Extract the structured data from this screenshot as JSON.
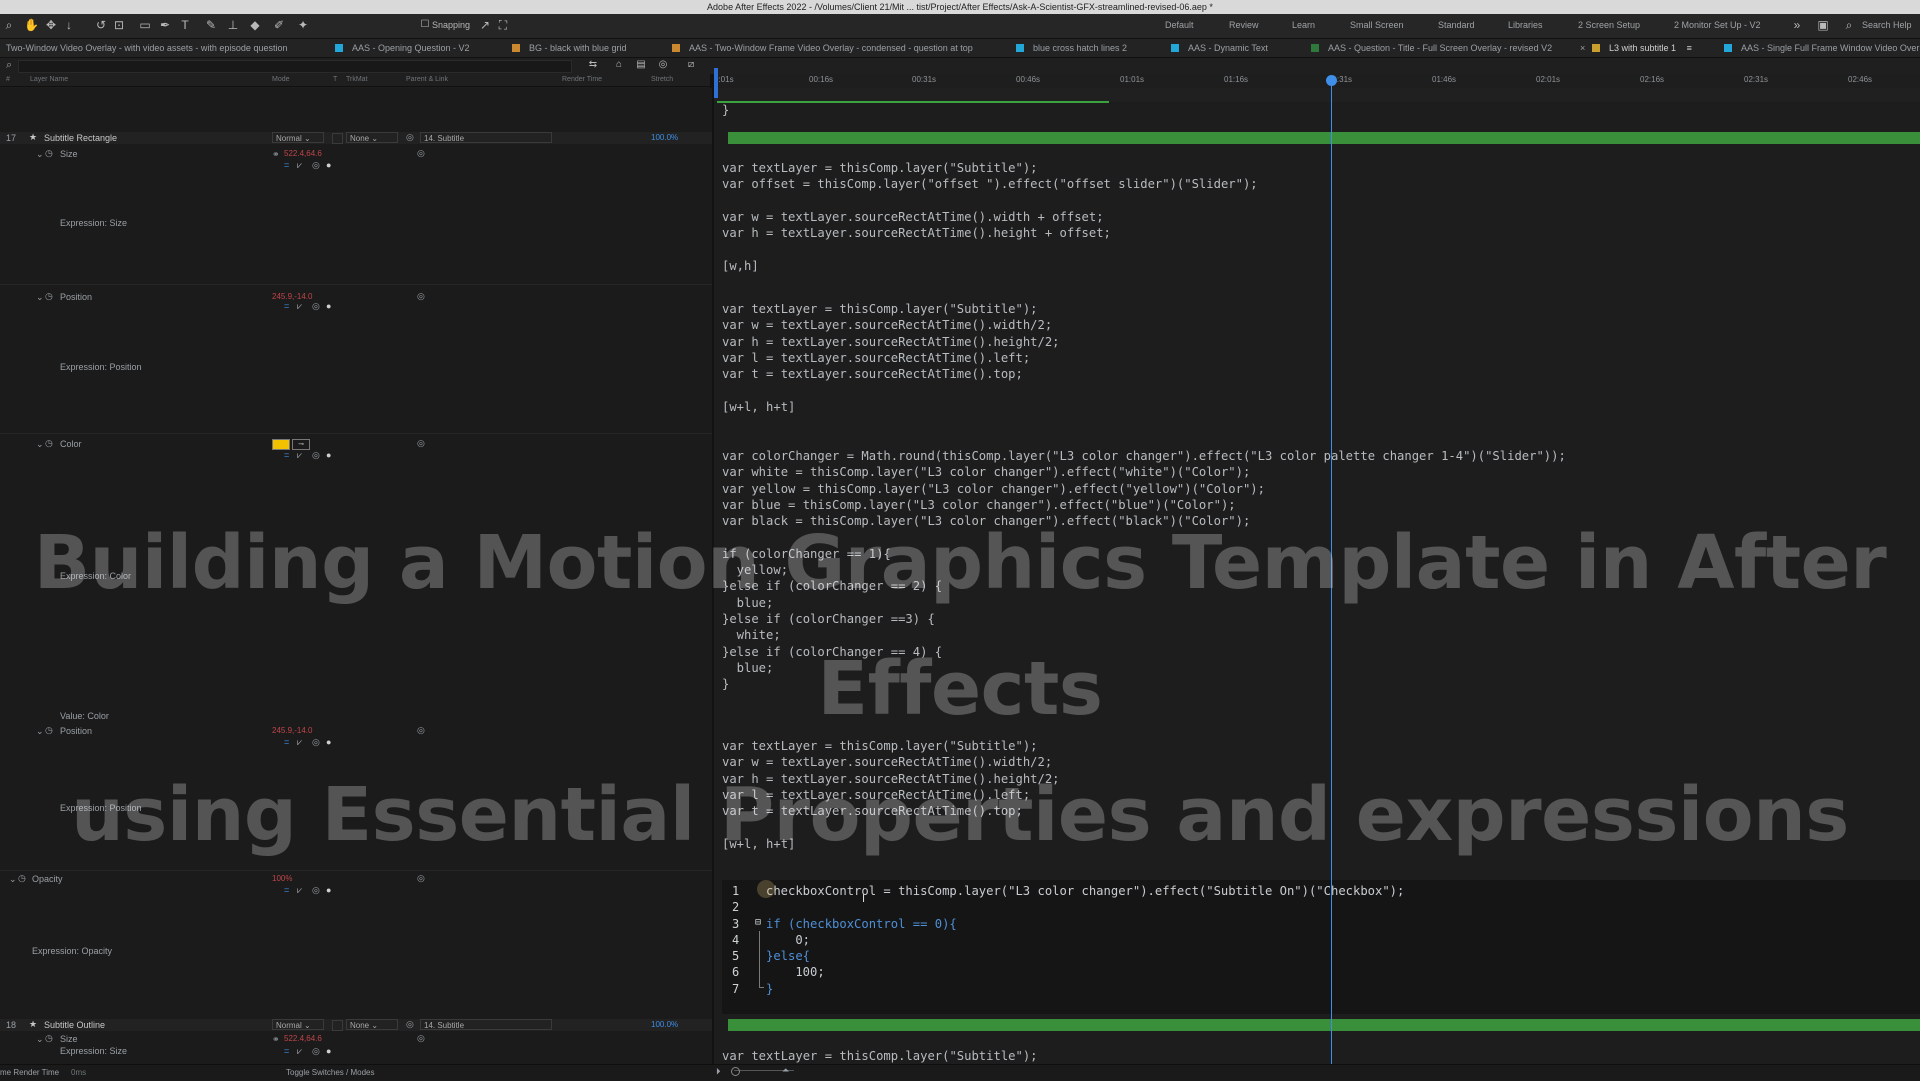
{
  "window": {
    "title": "Adobe After Effects 2022 - /Volumes/Client 21/Mit ... tist/Project/After Effects/Ask-A-Scientist-GFX-streamlined-revised-06.aep *"
  },
  "toolbar": {
    "snapping_label": "Snapping",
    "workspaces": [
      "Default",
      "Review",
      "Learn",
      "Small Screen",
      "Standard",
      "Libraries",
      "2 Screen Setup",
      "2 Monitor Set Up - V2"
    ],
    "search_help": "Search Help"
  },
  "tabs": [
    {
      "label": "Two-Window Video Overlay - with video assets - with episode question",
      "color": ""
    },
    {
      "label": "AAS - Opening Question - V2",
      "color": "#23a7d8"
    },
    {
      "label": "BG - black with blue grid",
      "color": "#c98a2f"
    },
    {
      "label": "AAS - Two-Window Frame Video Overlay - condensed - question at top",
      "color": "#c98a2f"
    },
    {
      "label": "blue cross hatch lines 2",
      "color": "#23a7d8"
    },
    {
      "label": "AAS - Dynamic Text",
      "color": "#23a7d8"
    },
    {
      "label": "AAS - Question - Title - Full Screen Overlay - revised V2",
      "color": "#2f7a3a"
    },
    {
      "label": "L3 with subtitle 1",
      "color": "#c9a030",
      "active": true
    },
    {
      "label": "AAS - Single Full Frame Window Video Over",
      "color": "#23a7d8"
    }
  ],
  "columns": {
    "num": "#",
    "layer_name": "Layer Name",
    "mode": "Mode",
    "t": "T",
    "trkmat": "TrkMat",
    "parent": "Parent & Link",
    "render_time": "Render Time",
    "stretch": "Stretch"
  },
  "ruler": [
    "0:01s",
    "00:16s",
    "00:31s",
    "00:46s",
    "01:01s",
    "01:16s",
    "01:31s",
    "01:46s",
    "02:01s",
    "02:16s",
    "02:31s",
    "02:46s"
  ],
  "layers": {
    "l17": {
      "num": "17",
      "name": "Subtitle Rectangle",
      "mode": "Normal",
      "trkmat": "None",
      "parent": "14. Subtitle",
      "stretch": "100.0%"
    },
    "l18": {
      "num": "18",
      "name": "Subtitle Outline",
      "mode": "Normal",
      "trkmat": "None",
      "parent": "14. Subtitle",
      "stretch": "100.0%"
    }
  },
  "props": {
    "size": {
      "label": "Size",
      "value": "522.4,64.6",
      "expr": "Expression: Size"
    },
    "position1": {
      "label": "Position",
      "value": "245.9,-14.0",
      "expr": "Expression: Position"
    },
    "color": {
      "label": "Color",
      "expr": "Expression: Color",
      "swatch": "#f2c200",
      "value_label": "Value: Color"
    },
    "position2": {
      "label": "Position",
      "value": "245.9,-14.0",
      "expr": "Expression: Position"
    },
    "opacity": {
      "label": "Opacity",
      "value": "100%",
      "expr": "Expression: Opacity"
    },
    "size2": {
      "label": "Size",
      "value": "522.4,64.6",
      "expr": "Expression: Size"
    }
  },
  "code": {
    "top_brace": "}",
    "size": "var textLayer = thisComp.layer(\"Subtitle\");\nvar offset = thisComp.layer(\"offset \").effect(\"offset slider\")(\"Slider\");\n\nvar w = textLayer.sourceRectAtTime().width + offset;\nvar h = textLayer.sourceRectAtTime().height + offset;\n\n[w,h]",
    "position1": "var textLayer = thisComp.layer(\"Subtitle\");\nvar w = textLayer.sourceRectAtTime().width/2;\nvar h = textLayer.sourceRectAtTime().height/2;\nvar l = textLayer.sourceRectAtTime().left;\nvar t = textLayer.sourceRectAtTime().top;\n\n[w+l, h+t]",
    "color": "var colorChanger = Math.round(thisComp.layer(\"L3 color changer\").effect(\"L3 color palette changer 1-4\")(\"Slider\"));\nvar white = thisComp.layer(\"L3 color changer\").effect(\"white\")(\"Color\");\nvar yellow = thisComp.layer(\"L3 color changer\").effect(\"yellow\")(\"Color\");\nvar blue = thisComp.layer(\"L3 color changer\").effect(\"blue\")(\"Color\");\nvar black = thisComp.layer(\"L3 color changer\").effect(\"black\")(\"Color\");\n\nif (colorChanger == 1){\n  yellow;\n}else if (colorChanger == 2) {\n  blue;\n}else if (colorChanger ==3) {\n  white;\n}else if (colorChanger == 4) {\n  blue;\n}",
    "position2": "var textLayer = thisComp.layer(\"Subtitle\");\nvar w = textLayer.sourceRectAtTime().width/2;\nvar h = textLayer.sourceRectAtTime().height/2;\nvar l = textLayer.sourceRectAtTime().left;\nvar t = textLayer.sourceRectAtTime().top;\n\n[w+l, h+t]",
    "bottom": "var textLayer = thisComp.layer(\"Subtitle\");"
  },
  "editor": {
    "lines": [
      {
        "n": "1",
        "text": "checkboxControl = thisComp.layer(\"L3 color changer\").effect(\"Subtitle On\")(\"Checkbox\");"
      },
      {
        "n": "2",
        "text": ""
      },
      {
        "n": "3",
        "text": "if (checkboxControl == 0){"
      },
      {
        "n": "4",
        "text": "    0;"
      },
      {
        "n": "5",
        "text": "}else{"
      },
      {
        "n": "6",
        "text": "    100;"
      },
      {
        "n": "7",
        "text": "}"
      }
    ]
  },
  "overlay": {
    "line1": "Building a Motion Graphics Template in After Effects",
    "line2": "using Essential Properties and expressions"
  },
  "footer": {
    "render_label": "me Render Time",
    "render_value": "0ms",
    "toggle": "Toggle Switches / Modes"
  }
}
